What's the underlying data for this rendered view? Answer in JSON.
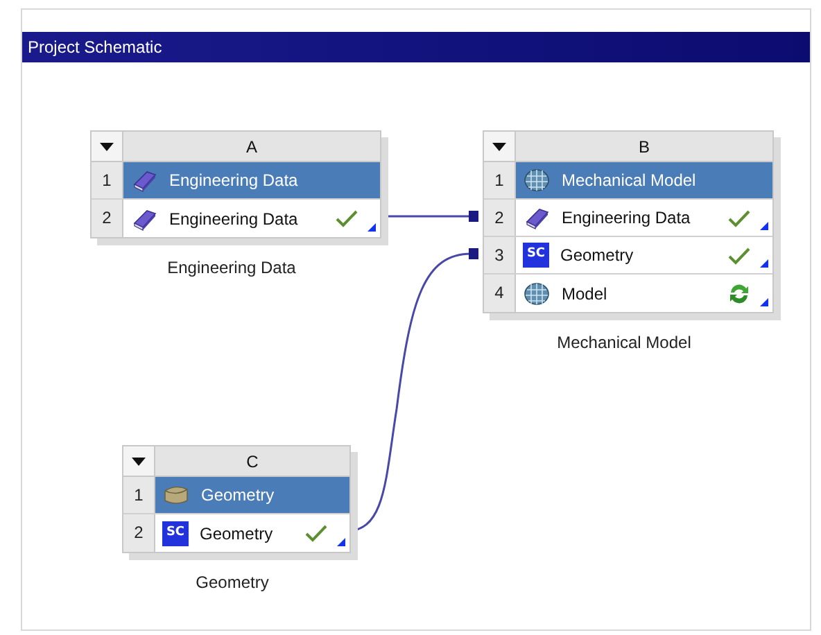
{
  "panel": {
    "title": "Project Schematic"
  },
  "systems": [
    {
      "column": "A",
      "caption": "Engineering Data",
      "rows": [
        {
          "number": "1",
          "icon": {
            "kind": "book"
          },
          "label": "Engineering Data",
          "selected": true
        },
        {
          "number": "2",
          "icon": {
            "kind": "book"
          },
          "label": "Engineering Data",
          "selected": false,
          "status": {
            "kind": "ok"
          }
        }
      ]
    },
    {
      "column": "B",
      "caption": "Mechanical Model",
      "rows": [
        {
          "number": "1",
          "icon": {
            "kind": "mesh"
          },
          "label": "Mechanical Model",
          "selected": true
        },
        {
          "number": "2",
          "icon": {
            "kind": "book"
          },
          "label": "Engineering Data",
          "selected": false,
          "status": {
            "kind": "ok"
          }
        },
        {
          "number": "3",
          "icon": {
            "kind": "sc",
            "badge": "SC"
          },
          "label": "Geometry",
          "selected": false,
          "status": {
            "kind": "ok"
          }
        },
        {
          "number": "4",
          "icon": {
            "kind": "mesh"
          },
          "label": "Model",
          "selected": false,
          "status": {
            "kind": "refresh"
          }
        }
      ]
    },
    {
      "column": "C",
      "caption": "Geometry",
      "rows": [
        {
          "number": "1",
          "icon": {
            "kind": "block"
          },
          "label": "Geometry",
          "selected": true
        },
        {
          "number": "2",
          "icon": {
            "kind": "sc",
            "badge": "SC"
          },
          "label": "Geometry",
          "selected": false,
          "status": {
            "kind": "ok"
          }
        }
      ]
    }
  ]
}
